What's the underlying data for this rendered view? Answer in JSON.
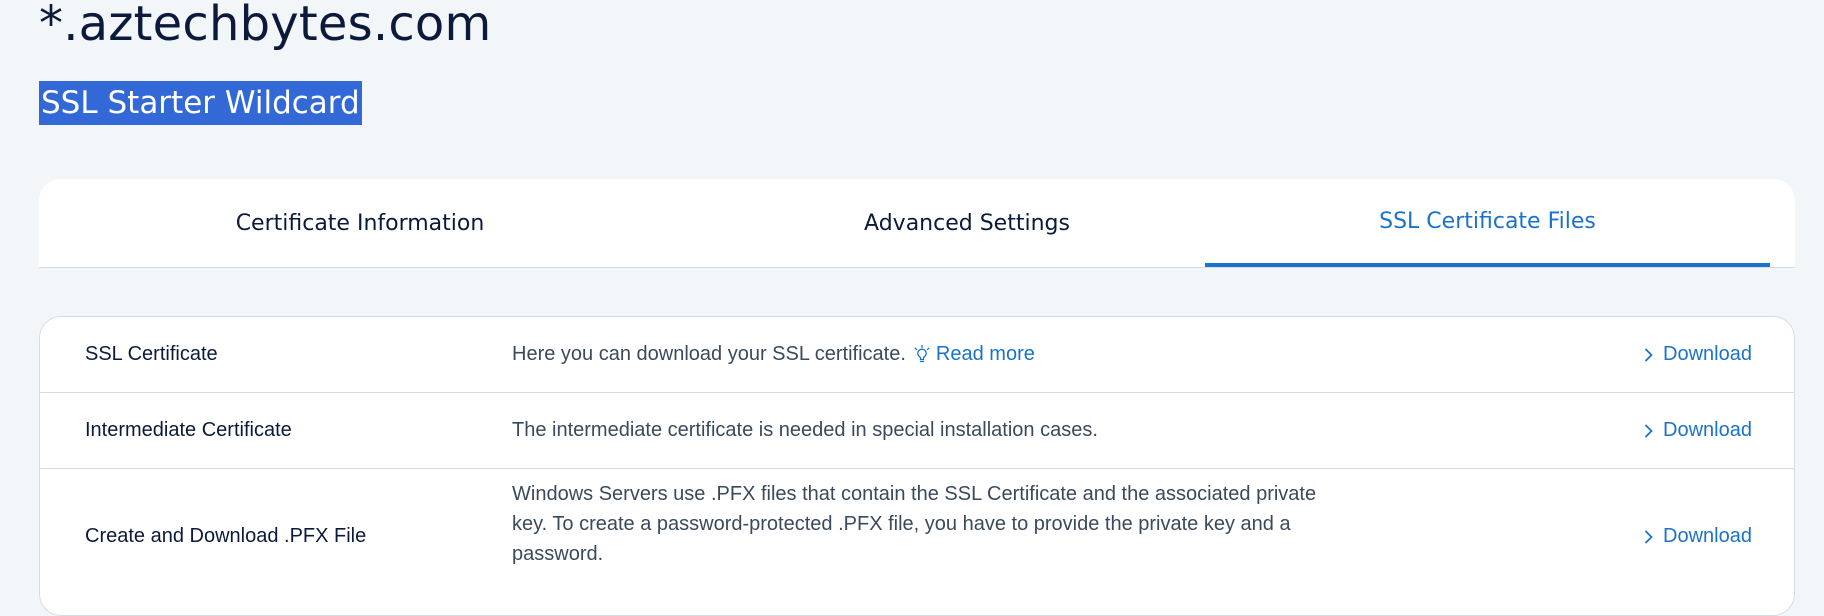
{
  "header": {
    "domain": "*.aztechbytes.com",
    "product": "SSL Starter Wildcard"
  },
  "tabs": [
    {
      "label": "Certificate Information",
      "active": false
    },
    {
      "label": "Advanced Settings",
      "active": false
    },
    {
      "label": "SSL Certificate Files",
      "active": true
    }
  ],
  "files": [
    {
      "name": "SSL Certificate",
      "description": "Here you can download your SSL certificate.",
      "link_label": "Read more",
      "action_label": "Download"
    },
    {
      "name": "Intermediate Certificate",
      "description": "The intermediate certificate is needed in special installation cases.",
      "action_label": "Download"
    },
    {
      "name": "Create and Download .PFX File",
      "description": "Windows Servers use .PFX files that contain the SSL Certificate and the associated private key. To create a password-protected .PFX file, you have to provide the private key and a password.",
      "action_label": "Download"
    }
  ],
  "icons": {
    "read_more": "lightbulb-icon",
    "download": "chevron-right-icon"
  },
  "colors": {
    "background": "#f3f6f9",
    "text_primary": "#0b1a3a",
    "text_secondary": "#3a4a5c",
    "accent": "#1a73c8",
    "selection_highlight": "#3369d6",
    "border": "#d4dce6"
  }
}
